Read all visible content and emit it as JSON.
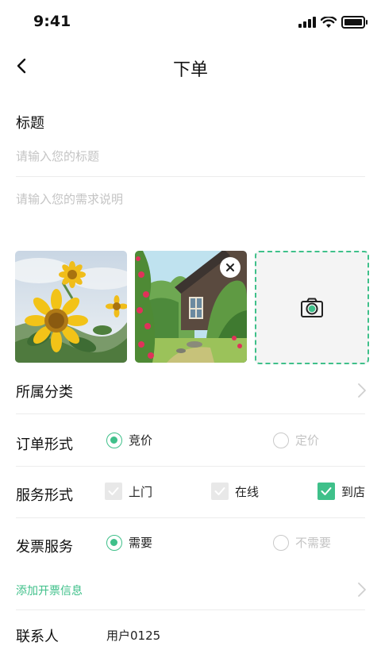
{
  "status": {
    "time": "9:41"
  },
  "nav": {
    "title": "下单"
  },
  "form": {
    "title_label": "标题",
    "title_placeholder": "请输入您的标题",
    "desc_placeholder": "请输入您的需求说明"
  },
  "category": {
    "label": "所属分类"
  },
  "order_form": {
    "label": "订单形式",
    "options": [
      {
        "label": "竞价",
        "selected": true
      },
      {
        "label": "定价",
        "selected": false
      }
    ]
  },
  "service_form": {
    "label": "服务形式",
    "options": [
      {
        "label": "上门",
        "checked": false
      },
      {
        "label": "在线",
        "checked": false
      },
      {
        "label": "到店",
        "checked": true
      }
    ]
  },
  "invoice": {
    "label": "发票服务",
    "options": [
      {
        "label": "需要",
        "selected": true
      },
      {
        "label": "不需要",
        "selected": false
      }
    ],
    "add_info_link": "添加开票信息"
  },
  "contact": {
    "label": "联系人",
    "value": "用户0125"
  },
  "colors": {
    "accent": "#3fc08a",
    "placeholder": "#c4c4c4"
  },
  "icons": [
    "back-arrow-icon",
    "close-icon",
    "camera-icon",
    "chevron-right-icon",
    "check-icon"
  ]
}
